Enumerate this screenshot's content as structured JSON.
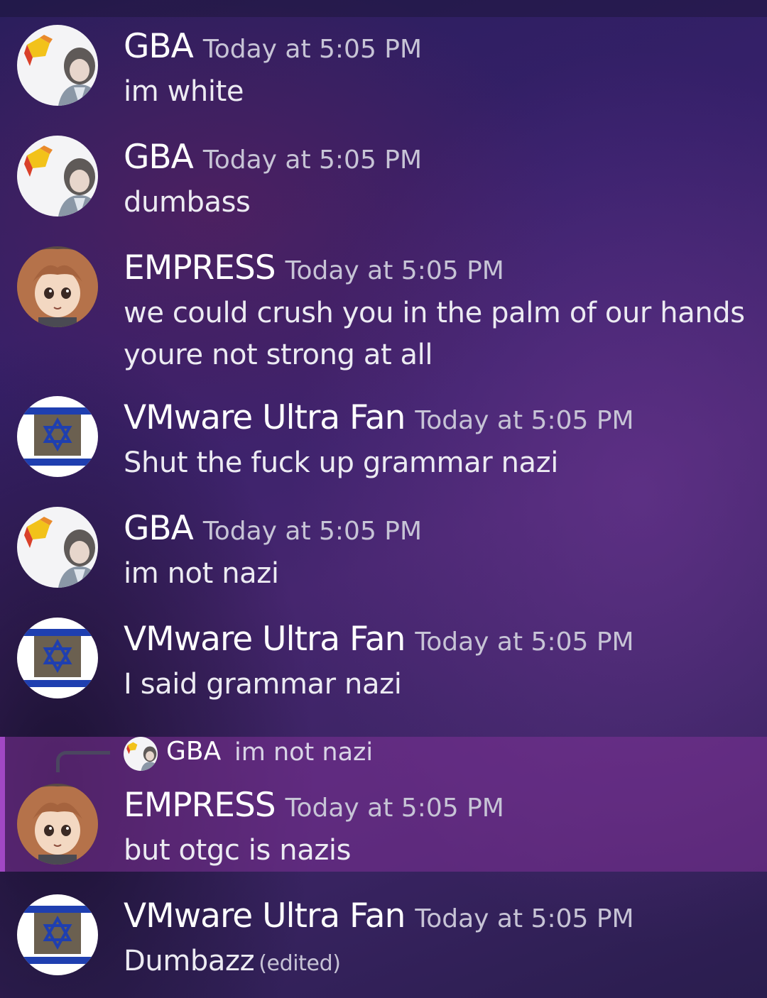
{
  "messages": [
    {
      "username": "GBA",
      "timestamp": "Today at 5:05 PM",
      "lines": [
        "im white"
      ],
      "avatar": "gba-avatar"
    },
    {
      "username": "GBA",
      "timestamp": "Today at 5:05 PM",
      "lines": [
        "dumbass"
      ],
      "avatar": "gba-avatar"
    },
    {
      "username": "EMPRESS",
      "timestamp": "Today at 5:05 PM",
      "lines": [
        "we could crush you in the palm of our hands",
        "youre not strong at all"
      ],
      "avatar": "empress-avatar"
    },
    {
      "username": "VMware Ultra Fan",
      "timestamp": "Today at 5:05 PM",
      "lines": [
        "Shut the fuck up grammar nazi"
      ],
      "avatar": "vmware-avatar"
    },
    {
      "username": "GBA",
      "timestamp": "Today at 5:05 PM",
      "lines": [
        "im not nazi"
      ],
      "avatar": "gba-avatar"
    },
    {
      "username": "VMware Ultra Fan",
      "timestamp": "Today at 5:05 PM",
      "lines": [
        "I said grammar nazi"
      ],
      "avatar": "vmware-avatar"
    },
    {
      "username": "EMPRESS",
      "timestamp": "Today at 5:05 PM",
      "lines": [
        "but otgc is nazis"
      ],
      "avatar": "empress-avatar",
      "reply": {
        "username": "GBA",
        "text": "im not nazi"
      }
    },
    {
      "username": "VMware Ultra Fan",
      "timestamp": "Today at 5:05 PM",
      "lines": [
        "Dumbazz"
      ],
      "edited": "(edited)",
      "avatar": "vmware-avatar"
    }
  ],
  "colors": {
    "highlight": "#7e3296",
    "highlight_bar": "#a148c4",
    "timestamp": "#c7c4d6"
  }
}
